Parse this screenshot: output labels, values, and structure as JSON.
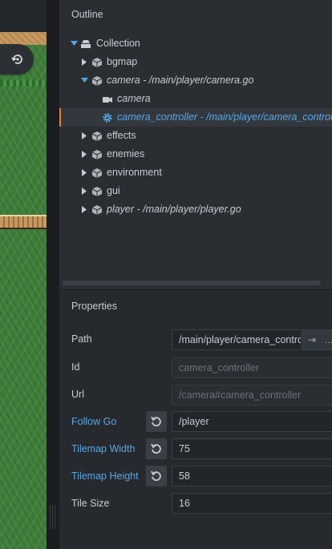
{
  "outline": {
    "title": "Outline",
    "items": [
      {
        "label": "Collection",
        "icon": "collection-icon"
      },
      {
        "label": "bgmap",
        "icon": "game-object-icon"
      },
      {
        "label": "camera - /main/player/camera.go",
        "icon": "game-object-icon"
      },
      {
        "label": "camera",
        "icon": "camera-icon"
      },
      {
        "label": "camera_controller - /main/player/camera_controller",
        "icon": "script-gear-icon"
      },
      {
        "label": "effects",
        "icon": "game-object-icon"
      },
      {
        "label": "enemies",
        "icon": "game-object-icon"
      },
      {
        "label": "environment",
        "icon": "game-object-icon"
      },
      {
        "label": "gui",
        "icon": "game-object-icon"
      },
      {
        "label": "player - /main/player/player.go",
        "icon": "game-object-icon"
      }
    ]
  },
  "properties": {
    "title": "Properties",
    "path": {
      "label": "Path",
      "value": "/main/player/camera_controller",
      "goto_symbol": "⇥",
      "more_symbol": "..."
    },
    "id": {
      "label": "Id",
      "value": "camera_controller"
    },
    "url": {
      "label": "Url",
      "value": "/camera#camera_controller"
    },
    "follow_go": {
      "label": "Follow Go",
      "value": "/player"
    },
    "tilemap_width": {
      "label": "Tilemap Width",
      "value": "75"
    },
    "tilemap_height": {
      "label": "Tilemap Height",
      "value": "58"
    },
    "tile_size": {
      "label": "Tile Size",
      "value": "16"
    }
  },
  "colors": {
    "accent_blue": "#58a6e6",
    "selection_marker": "#e0833a"
  }
}
